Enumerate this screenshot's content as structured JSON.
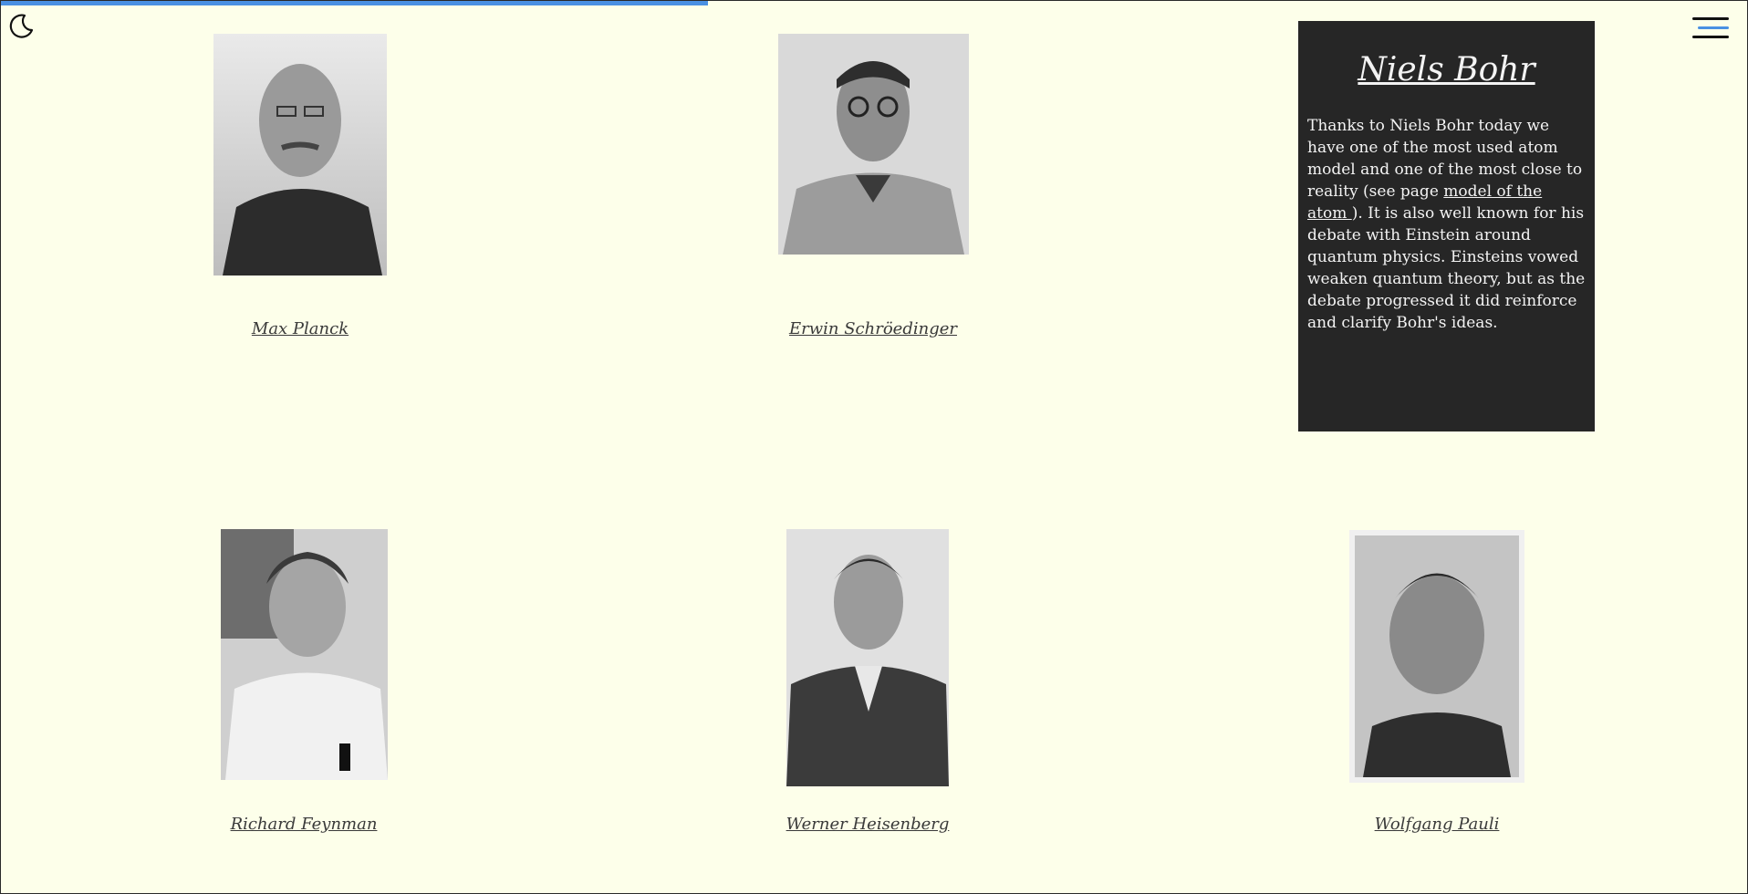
{
  "progress": {
    "value": 0.405,
    "color": "#4a90e2"
  },
  "header": {
    "theme_icon": "moon-icon",
    "menu_icon": "hamburger-menu-icon"
  },
  "scientists": [
    {
      "name": "Max Planck",
      "photo": "portrait-photo"
    },
    {
      "name": "Erwin Schröedinger",
      "photo": "portrait-photo"
    },
    {
      "name": "Richard Feynman",
      "photo": "portrait-photo"
    },
    {
      "name": "Werner Heisenberg",
      "photo": "portrait-photo"
    },
    {
      "name": "Wolfgang Pauli",
      "photo": "portrait-photo"
    }
  ],
  "bio": {
    "title": "Niels Bohr",
    "text_before_link": "Thanks to Niels Bohr today we have one of the most used atom model and one of the most close to reality (see page ",
    "link_text": "model of the atom ",
    "text_after_link": "). It is also well known for his debate with Einstein around quantum physics. Einsteins vowed weaken quantum theory, but as the debate progressed it did reinforce and clarify Bohr's ideas."
  },
  "colors": {
    "background": "#fdffea",
    "panel": "#262626",
    "accent": "#4a90e2"
  }
}
